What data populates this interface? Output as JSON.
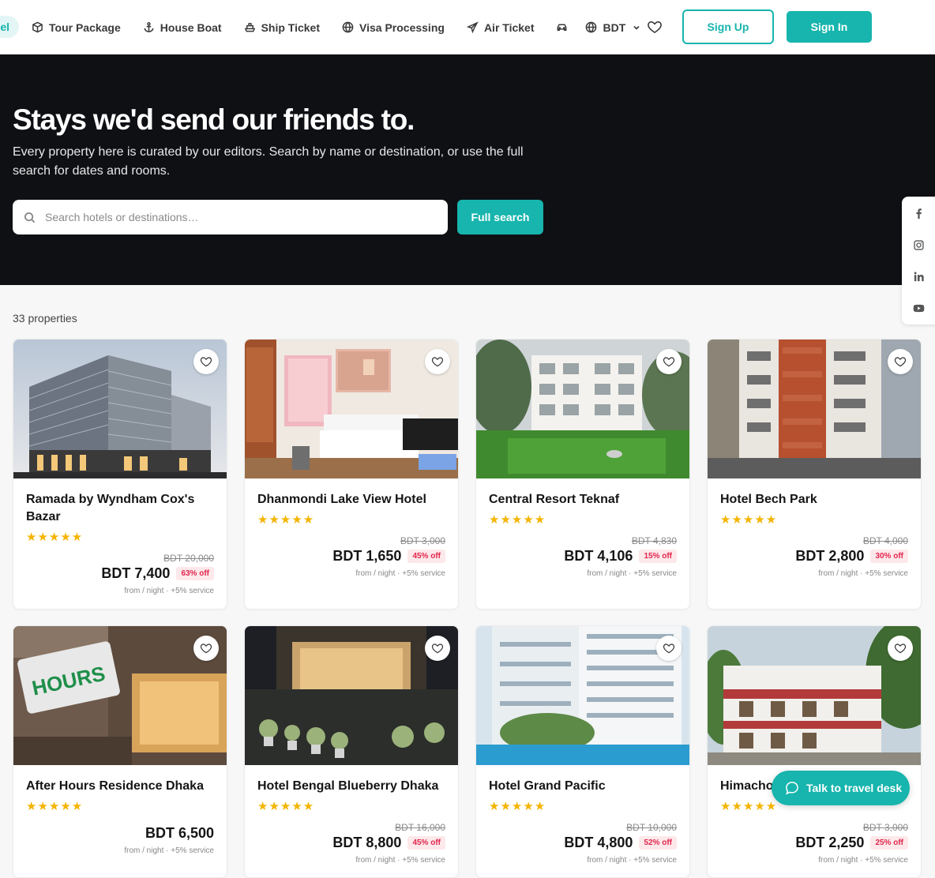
{
  "nav": {
    "partial_label": "el",
    "items": [
      {
        "label": "Tour Package",
        "icon": "package-icon"
      },
      {
        "label": "House Boat",
        "icon": "anchor-icon"
      },
      {
        "label": "Ship Ticket",
        "icon": "ship-icon"
      },
      {
        "label": "Visa Processing",
        "icon": "globe-icon"
      },
      {
        "label": "Air Ticket",
        "icon": "plane-icon"
      }
    ],
    "car_icon": "car-icon",
    "currency": "BDT",
    "signup_label": "Sign Up",
    "signin_label": "Sign In"
  },
  "hero": {
    "title": "Stays we'd send our friends to.",
    "subtitle": "Every property here is curated by our editors. Search by name or destination, or use the full search for dates and rooms.",
    "search_placeholder": "Search hotels or destinations…",
    "full_search_label": "Full search"
  },
  "social": [
    "facebook-icon",
    "instagram-icon",
    "linkedin-icon",
    "youtube-icon"
  ],
  "results": {
    "count_label": "33 properties"
  },
  "hotels": [
    {
      "name": "Ramada by Wyndham Cox's Bazar",
      "stars": "★★★★★",
      "old_price": "BDT 20,000",
      "price": "BDT 7,400",
      "discount": "63% off",
      "note": "from / night · +5% service"
    },
    {
      "name": "Dhanmondi Lake View Hotel",
      "stars": "★★★★★",
      "old_price": "BDT 3,000",
      "price": "BDT 1,650",
      "discount": "45% off",
      "note": "from / night · +5% service"
    },
    {
      "name": "Central Resort Teknaf",
      "stars": "★★★★★",
      "old_price": "BDT 4,830",
      "price": "BDT 4,106",
      "discount": "15% off",
      "note": "from / night · +5% service"
    },
    {
      "name": "Hotel Bech Park",
      "stars": "★★★★★",
      "old_price": "BDT 4,000",
      "price": "BDT 2,800",
      "discount": "30% off",
      "note": "from / night · +5% service"
    },
    {
      "name": "After Hours Residence Dhaka",
      "stars": "★★★★★",
      "old_price": "",
      "price": "BDT 6,500",
      "discount": "",
      "note": "from / night · +5% service"
    },
    {
      "name": "Hotel Bengal Blueberry Dhaka",
      "stars": "★★★★★",
      "old_price": "BDT 16,000",
      "price": "BDT 8,800",
      "discount": "45% off",
      "note": "from / night · +5% service"
    },
    {
      "name": "Hotel Grand Pacific",
      "stars": "★★★★★",
      "old_price": "BDT 10,000",
      "price": "BDT 4,800",
      "discount": "52% off",
      "note": "from / night · +5% service"
    },
    {
      "name": "Himachol",
      "stars": "★★★★★",
      "old_price": "BDT 3,000",
      "price": "BDT 2,250",
      "discount": "25% off",
      "note": "from / night · +5% service"
    }
  ],
  "chat": {
    "label": "Talk to travel desk"
  },
  "colors": {
    "accent": "#17b5ad",
    "hero_bg": "#0f1014",
    "star": "#f5b400",
    "discount": "#e2264d"
  }
}
